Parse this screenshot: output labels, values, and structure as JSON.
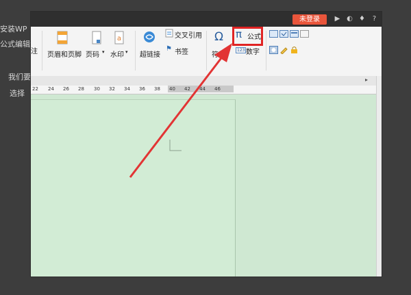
{
  "background": {
    "left_text_1": "安装WP",
    "left_text_2": "公式编辑",
    "left_text_3": "我们要",
    "left_text_4": "选择",
    "left_text_5": "注"
  },
  "titlebar": {
    "login_label": "未登录"
  },
  "ribbon": {
    "header_footer_label": "页眉和页脚",
    "page_number_label": "页码",
    "watermark_label": "水印",
    "hyperlink_label": "超链接",
    "cross_ref_label": "交叉引用",
    "bookmark_label": "书签",
    "symbol_label": "符号",
    "formula_label": "公式",
    "number_label": "数字",
    "pi_symbol": "π",
    "omega_symbol": "Ω",
    "number_icon_text": "123"
  },
  "ruler": {
    "ticks": [
      "22",
      "24",
      "26",
      "28",
      "30",
      "32",
      "34",
      "36",
      "38",
      "40",
      "42",
      "44",
      "46"
    ]
  },
  "colors": {
    "accent_red": "#e02323",
    "login_orange": "#e9553b",
    "doc_green": "#cfe8d2"
  }
}
